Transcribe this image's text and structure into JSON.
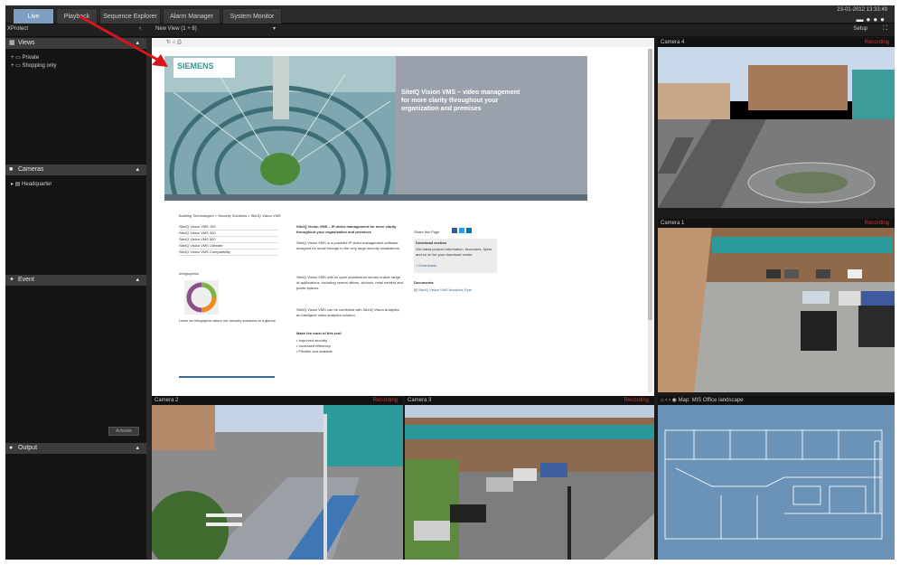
{
  "tabs": [
    {
      "label": "Live",
      "active": true
    },
    {
      "label": "Playback",
      "active": false
    },
    {
      "label": "Sequence Explorer",
      "active": false
    },
    {
      "label": "Alarm Manager",
      "active": false
    },
    {
      "label": "System Monitor",
      "active": false
    }
  ],
  "clock": "23-01-2012 13:33:49",
  "subbar": {
    "left_title": "XProtect",
    "view_selector": "New View (1 + 8)",
    "setup_label": "Setup"
  },
  "sidebar": {
    "views": {
      "title": "Views",
      "items": [
        "Private",
        "Shopping only"
      ]
    },
    "cameras": {
      "title": "Cameras",
      "items": [
        "Headquarter"
      ]
    },
    "event": {
      "title": "Event",
      "button": "Activate"
    },
    "output": {
      "title": "Output"
    }
  },
  "cameras": {
    "cam_right_top": {
      "name": "Camera 4",
      "rec": "Recording"
    },
    "cam_right_mid": {
      "name": "Camera 1",
      "rec": "Recording"
    },
    "cam_bottom_left": {
      "name": "Camera 2",
      "rec": "Recording"
    },
    "cam_bottom_mid": {
      "name": "Camera 3",
      "rec": "Recording"
    },
    "map": {
      "name": "Map: MIS Office landscape",
      "controls": "⌂ ‹ ›"
    }
  },
  "web": {
    "brand": "SIEMENS",
    "hero_title": "SiteIQ Vision VMS – video management for more clarity throughout your organization and premises",
    "breadcrumb": "Building Technologies > Security Solutions > SiteIQ Vision VMS",
    "nav_items": [
      "SiteIQ Vision VMS 100",
      "SiteIQ Vision VMS 300",
      "SiteIQ Vision VMS 500",
      "SiteIQ Vision VMS Ultimate",
      "SiteIQ Vision VMS Compatibility"
    ],
    "infographic_label": "Infographics",
    "infographic_caption": "Learn an infographic about our security solutions at a glance",
    "body_title": "SiteIQ Vision VMS – IP-video management for more clarity throughout your organization and premises",
    "body_paragraphs": [
      "SiteIQ Vision VMS is a powerful IP video management software designed for small through to the very large security installations.",
      "SiteIQ Vision VMS with its open architecture serves a wide range of applications, including central offices, schools, retail centers and public spaces.",
      "SiteIQ Vision VMS can be combined with SiteIQ Vision Analytics, an intelligent video analytics solution."
    ],
    "features_label": "Make the most of this tool:",
    "features": [
      "Improved security",
      "Increased efficiency",
      "Flexible and scalable"
    ],
    "share_label": "Share this Page",
    "download_title": "Download section",
    "download_text": "Get latest product information, brochures, flyers and so on for your download center.",
    "download_link": "Downloads",
    "documents_label": "Documents",
    "document_item": "SiteIQ Vision VMS Analytics Flyer"
  }
}
